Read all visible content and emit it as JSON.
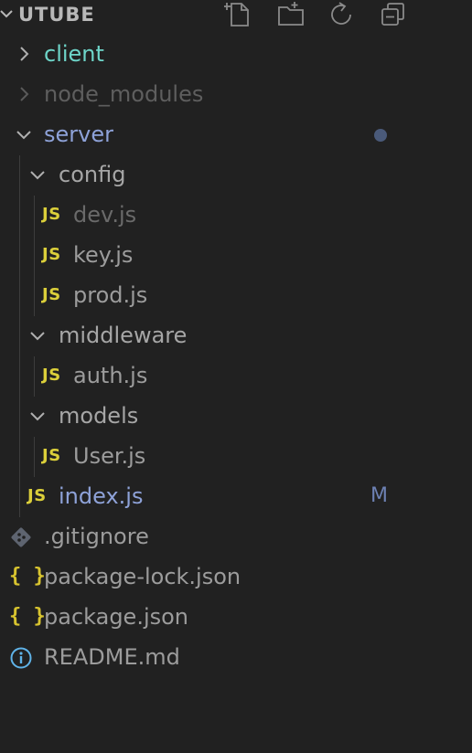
{
  "header": {
    "title": "UTUBE",
    "actions": [
      {
        "name": "new-file-icon",
        "label": "New File"
      },
      {
        "name": "new-folder-icon",
        "label": "New Folder"
      },
      {
        "name": "refresh-icon",
        "label": "Refresh Explorer"
      },
      {
        "name": "collapse-all-icon",
        "label": "Collapse Folders"
      }
    ]
  },
  "tree": {
    "client": "client",
    "node_modules": "node_modules",
    "server": "server",
    "config": "config",
    "dev_js": "dev.js",
    "key_js": "key.js",
    "prod_js": "prod.js",
    "middleware": "middleware",
    "auth_js": "auth.js",
    "models": "models",
    "user_js": "User.js",
    "index_js": "index.js",
    "gitignore": ".gitignore",
    "package_lock": "package-lock.json",
    "package_json": "package.json",
    "readme": "README.md"
  },
  "icons": {
    "js": "JS",
    "json": "{ }"
  },
  "status": {
    "index_js": "M"
  },
  "colors": {
    "background": "#212121",
    "js_icon": "#dbcf3a",
    "json_icon": "#d8c42f",
    "client": "#6ed5c9",
    "modified": "#8ea2d8",
    "info_icon": "#5fb3e8"
  }
}
